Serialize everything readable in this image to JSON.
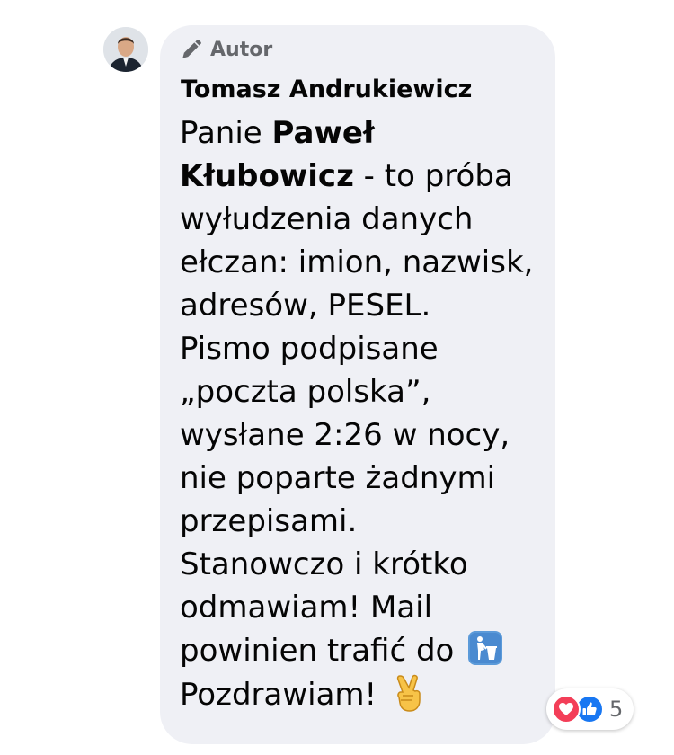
{
  "comment": {
    "badge_label": "Autor",
    "author_name": "Tomasz Andrukiewicz",
    "message": {
      "l1_text": "Panie ",
      "l1_bold": "Paweł",
      "l2_bold": "Kłubowicz",
      "l2_text": " - to próba",
      "l3": "wyłudzenia danych",
      "l4": "ełczan: imion, nazwisk,",
      "l5": "adresów, PESEL.",
      "l6": "Pismo podpisane",
      "l7": "„poczta polska”,",
      "l8": "wysłane 2:26 w nocy,",
      "l9": "nie poparte żadnymi",
      "l10": "przepisami.",
      "l11": "Stanowczo i krótko",
      "l12": "odmawiam! Mail",
      "l13": "powinien trafić do",
      "l14": "Pozdrawiam!"
    },
    "emojis": {
      "inline_1": "litter-in-bin-icon",
      "inline_2": "victory-hand-icon"
    },
    "reactions": {
      "icons": [
        "love-icon",
        "like-icon"
      ],
      "count": "5"
    }
  },
  "colors": {
    "bubble": "#eff0f5",
    "text": "#050505",
    "muted": "#65676b",
    "love": "#f33e58",
    "like": "#1877f2"
  }
}
